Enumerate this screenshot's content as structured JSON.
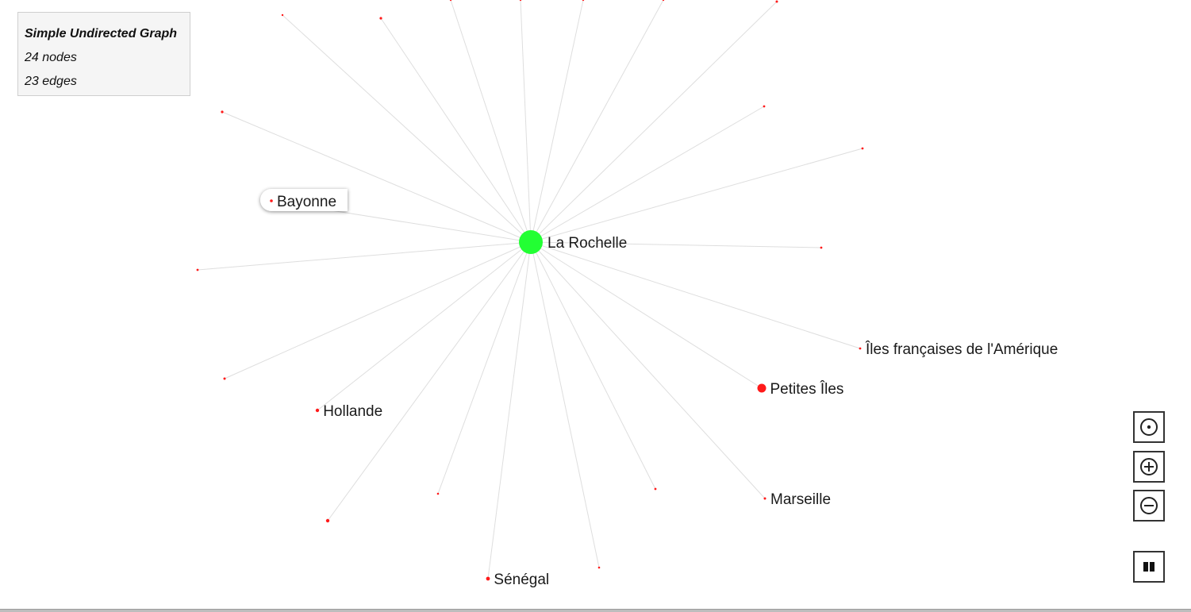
{
  "info": {
    "title": "Simple Undirected Graph",
    "nodes": "24 nodes",
    "edges": "23 edges"
  },
  "graph": {
    "center": {
      "id": "la-rochelle",
      "label": "La Rochelle",
      "color": "#22ff33"
    },
    "node_color": "#ff1a1a",
    "edge_color": "#dedede",
    "hovered_node": "Bayonne",
    "labeled_nodes": [
      "Bayonne",
      "Îles françaises de l'Amérique",
      "Petites Îles",
      "Hollande",
      "Marseille",
      "Sénégal"
    ]
  },
  "controls": [
    {
      "name": "center-view-button",
      "icon": "target-icon"
    },
    {
      "name": "zoom-in-button",
      "icon": "zoom-in-icon"
    },
    {
      "name": "zoom-out-button",
      "icon": "zoom-out-icon"
    },
    {
      "name": "pause-layout-button",
      "icon": "pause-icon"
    }
  ]
}
